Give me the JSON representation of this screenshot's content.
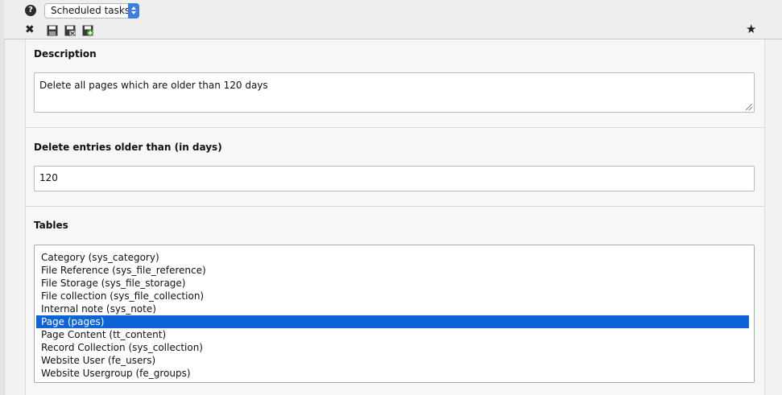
{
  "toolbar": {
    "help_icon": "question-circle-icon",
    "module_selector": "Scheduled tasks",
    "close_icon": "close-icon",
    "save_icons": [
      "save-icon",
      "save-and-close-icon",
      "save-and-new-icon"
    ],
    "bookmark_icon": "star-icon"
  },
  "form": {
    "description": {
      "label": "Description",
      "value": "Delete all pages which are older than 120 days"
    },
    "days": {
      "label": "Delete entries older than (in days)",
      "value": "120"
    },
    "tables": {
      "label": "Tables",
      "options": [
        "Category (sys_category)",
        "File Reference (sys_file_reference)",
        "File Storage (sys_file_storage)",
        "File collection (sys_file_collection)",
        "Internal note (sys_note)",
        "Page (pages)",
        "Page Content (tt_content)",
        "Record Collection (sys_collection)",
        "Website User (fe_users)",
        "Website Usergroup (fe_groups)"
      ],
      "selected": "Page (pages)"
    }
  },
  "colors": {
    "selection": "#0d64d8",
    "select_arrow": "#3b7de0"
  }
}
